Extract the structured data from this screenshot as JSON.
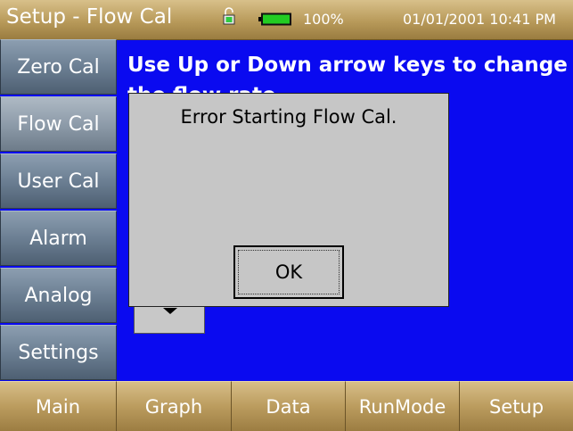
{
  "header": {
    "title": "Setup - Flow Cal",
    "battery_percent": "100%",
    "datetime": "01/01/2001 10:41 PM",
    "lock_icon": "unlocked-padlock-icon",
    "battery_icon": "battery-full-icon",
    "battery_color": "#22cc22"
  },
  "sidebar": {
    "items": [
      {
        "label": "Zero Cal"
      },
      {
        "label": "Flow Cal"
      },
      {
        "label": "User Cal"
      },
      {
        "label": "Alarm"
      },
      {
        "label": "Analog"
      },
      {
        "label": "Settings"
      }
    ]
  },
  "main": {
    "instruction": "Use Up or Down arrow keys to change the flow rate",
    "arrow_icon": "down-arrow-icon"
  },
  "dialog": {
    "message": "Error Starting Flow Cal.",
    "ok_label": "OK"
  },
  "bottom_nav": {
    "items": [
      {
        "label": "Main"
      },
      {
        "label": "Graph"
      },
      {
        "label": "Data"
      },
      {
        "label": "RunMode"
      },
      {
        "label": "Setup"
      }
    ]
  },
  "colors": {
    "background": "#0a0af0",
    "bar_gold": "#b89a5a",
    "sidebar_slate": "#6f8296",
    "dialog_gray": "#c6c6c6"
  }
}
